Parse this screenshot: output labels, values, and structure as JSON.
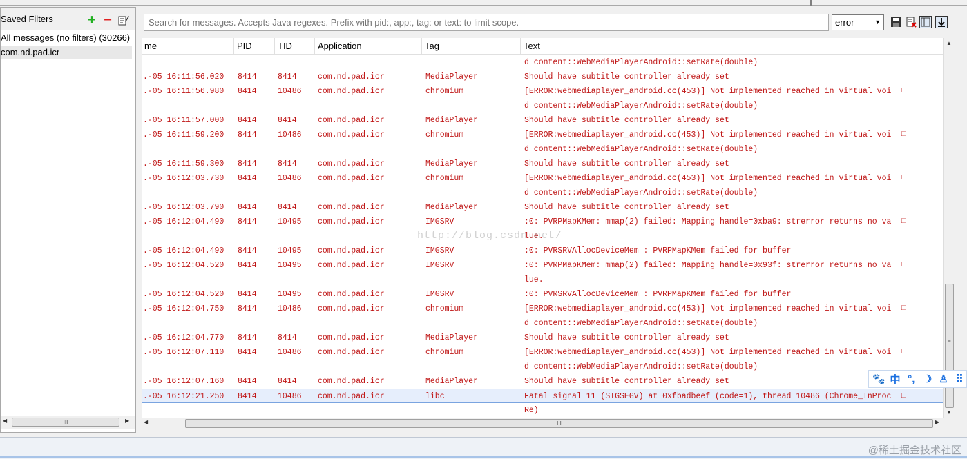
{
  "left_panel": {
    "title": "Saved Filters",
    "filters": [
      {
        "label": "All messages (no filters) (30266)"
      },
      {
        "label": "com.nd.pad.icr"
      }
    ]
  },
  "search": {
    "placeholder": "Search for messages. Accepts Java regexes. Prefix with pid:, app:, tag: or text: to limit scope."
  },
  "log_level": {
    "selected": "error"
  },
  "columns": [
    "me",
    "PID",
    "TID",
    "Application",
    "Tag",
    "Text"
  ],
  "rows": [
    {
      "time": "",
      "pid": "",
      "tid": "",
      "app": "",
      "tag": "",
      "text": "d content::WebMediaPlayerAndroid::setRate(double)",
      "trunc": ""
    },
    {
      "time": ".-05 16:11:56.020",
      "pid": "8414",
      "tid": "8414",
      "app": "com.nd.pad.icr",
      "tag": "MediaPlayer",
      "text": "Should have subtitle controller already set",
      "trunc": ""
    },
    {
      "time": ".-05 16:11:56.980",
      "pid": "8414",
      "tid": "10486",
      "app": "com.nd.pad.icr",
      "tag": "chromium",
      "text": "[ERROR:webmediaplayer_android.cc(453)] Not implemented reached in virtual voi",
      "trunc": "□"
    },
    {
      "time": "",
      "pid": "",
      "tid": "",
      "app": "",
      "tag": "",
      "text": "d content::WebMediaPlayerAndroid::setRate(double)",
      "trunc": ""
    },
    {
      "time": ".-05 16:11:57.000",
      "pid": "8414",
      "tid": "8414",
      "app": "com.nd.pad.icr",
      "tag": "MediaPlayer",
      "text": "Should have subtitle controller already set",
      "trunc": ""
    },
    {
      "time": ".-05 16:11:59.200",
      "pid": "8414",
      "tid": "10486",
      "app": "com.nd.pad.icr",
      "tag": "chromium",
      "text": "[ERROR:webmediaplayer_android.cc(453)] Not implemented reached in virtual voi",
      "trunc": "□"
    },
    {
      "time": "",
      "pid": "",
      "tid": "",
      "app": "",
      "tag": "",
      "text": "d content::WebMediaPlayerAndroid::setRate(double)",
      "trunc": ""
    },
    {
      "time": ".-05 16:11:59.300",
      "pid": "8414",
      "tid": "8414",
      "app": "com.nd.pad.icr",
      "tag": "MediaPlayer",
      "text": "Should have subtitle controller already set",
      "trunc": ""
    },
    {
      "time": ".-05 16:12:03.730",
      "pid": "8414",
      "tid": "10486",
      "app": "com.nd.pad.icr",
      "tag": "chromium",
      "text": "[ERROR:webmediaplayer_android.cc(453)] Not implemented reached in virtual voi",
      "trunc": "□"
    },
    {
      "time": "",
      "pid": "",
      "tid": "",
      "app": "",
      "tag": "",
      "text": "d content::WebMediaPlayerAndroid::setRate(double)",
      "trunc": ""
    },
    {
      "time": ".-05 16:12:03.790",
      "pid": "8414",
      "tid": "8414",
      "app": "com.nd.pad.icr",
      "tag": "MediaPlayer",
      "text": "Should have subtitle controller already set",
      "trunc": ""
    },
    {
      "time": ".-05 16:12:04.490",
      "pid": "8414",
      "tid": "10495",
      "app": "com.nd.pad.icr",
      "tag": "IMGSRV",
      "text": ":0: PVRPMapKMem: mmap(2) failed: Mapping handle=0xba9: strerror returns no va",
      "trunc": "□"
    },
    {
      "time": "",
      "pid": "",
      "tid": "",
      "app": "",
      "tag": "",
      "text": "lue.",
      "trunc": ""
    },
    {
      "time": ".-05 16:12:04.490",
      "pid": "8414",
      "tid": "10495",
      "app": "com.nd.pad.icr",
      "tag": "IMGSRV",
      "text": ":0: PVRSRVAllocDeviceMem : PVRPMapKMem failed for buffer",
      "trunc": ""
    },
    {
      "time": ".-05 16:12:04.520",
      "pid": "8414",
      "tid": "10495",
      "app": "com.nd.pad.icr",
      "tag": "IMGSRV",
      "text": ":0: PVRPMapKMem: mmap(2) failed: Mapping handle=0x93f: strerror returns no va",
      "trunc": "□"
    },
    {
      "time": "",
      "pid": "",
      "tid": "",
      "app": "",
      "tag": "",
      "text": "lue.",
      "trunc": ""
    },
    {
      "time": ".-05 16:12:04.520",
      "pid": "8414",
      "tid": "10495",
      "app": "com.nd.pad.icr",
      "tag": "IMGSRV",
      "text": ":0: PVRSRVAllocDeviceMem : PVRPMapKMem failed for buffer",
      "trunc": ""
    },
    {
      "time": ".-05 16:12:04.750",
      "pid": "8414",
      "tid": "10486",
      "app": "com.nd.pad.icr",
      "tag": "chromium",
      "text": "[ERROR:webmediaplayer_android.cc(453)] Not implemented reached in virtual voi",
      "trunc": "□"
    },
    {
      "time": "",
      "pid": "",
      "tid": "",
      "app": "",
      "tag": "",
      "text": "d content::WebMediaPlayerAndroid::setRate(double)",
      "trunc": ""
    },
    {
      "time": ".-05 16:12:04.770",
      "pid": "8414",
      "tid": "8414",
      "app": "com.nd.pad.icr",
      "tag": "MediaPlayer",
      "text": "Should have subtitle controller already set",
      "trunc": ""
    },
    {
      "time": ".-05 16:12:07.110",
      "pid": "8414",
      "tid": "10486",
      "app": "com.nd.pad.icr",
      "tag": "chromium",
      "text": "[ERROR:webmediaplayer_android.cc(453)] Not implemented reached in virtual voi",
      "trunc": "□"
    },
    {
      "time": "",
      "pid": "",
      "tid": "",
      "app": "",
      "tag": "",
      "text": "d content::WebMediaPlayerAndroid::setRate(double)",
      "trunc": ""
    },
    {
      "time": ".-05 16:12:07.160",
      "pid": "8414",
      "tid": "8414",
      "app": "com.nd.pad.icr",
      "tag": "MediaPlayer",
      "text": "Should have subtitle controller already set",
      "trunc": ""
    },
    {
      "time": ".-05 16:12:21.250",
      "pid": "8414",
      "tid": "10486",
      "app": "com.nd.pad.icr",
      "tag": "libc",
      "text": "Fatal signal 11 (SIGSEGV) at 0xfbadbeef (code=1), thread 10486 (Chrome_InProc",
      "trunc": "□",
      "selected": true
    },
    {
      "time": "",
      "pid": "",
      "tid": "",
      "app": "",
      "tag": "",
      "text": "Re)",
      "trunc": ""
    }
  ],
  "watermark": "http://blog.csdn.net/",
  "ime_bar": [
    "🐾",
    "中",
    "°,",
    "☽",
    "♙",
    "⠿"
  ],
  "brand": "@稀土掘金技术社区",
  "scroll_grip": "III",
  "colors": {
    "log_error": "#c01818",
    "selection": "#e6eefc",
    "add": "#22b022",
    "remove": "#e02020"
  }
}
